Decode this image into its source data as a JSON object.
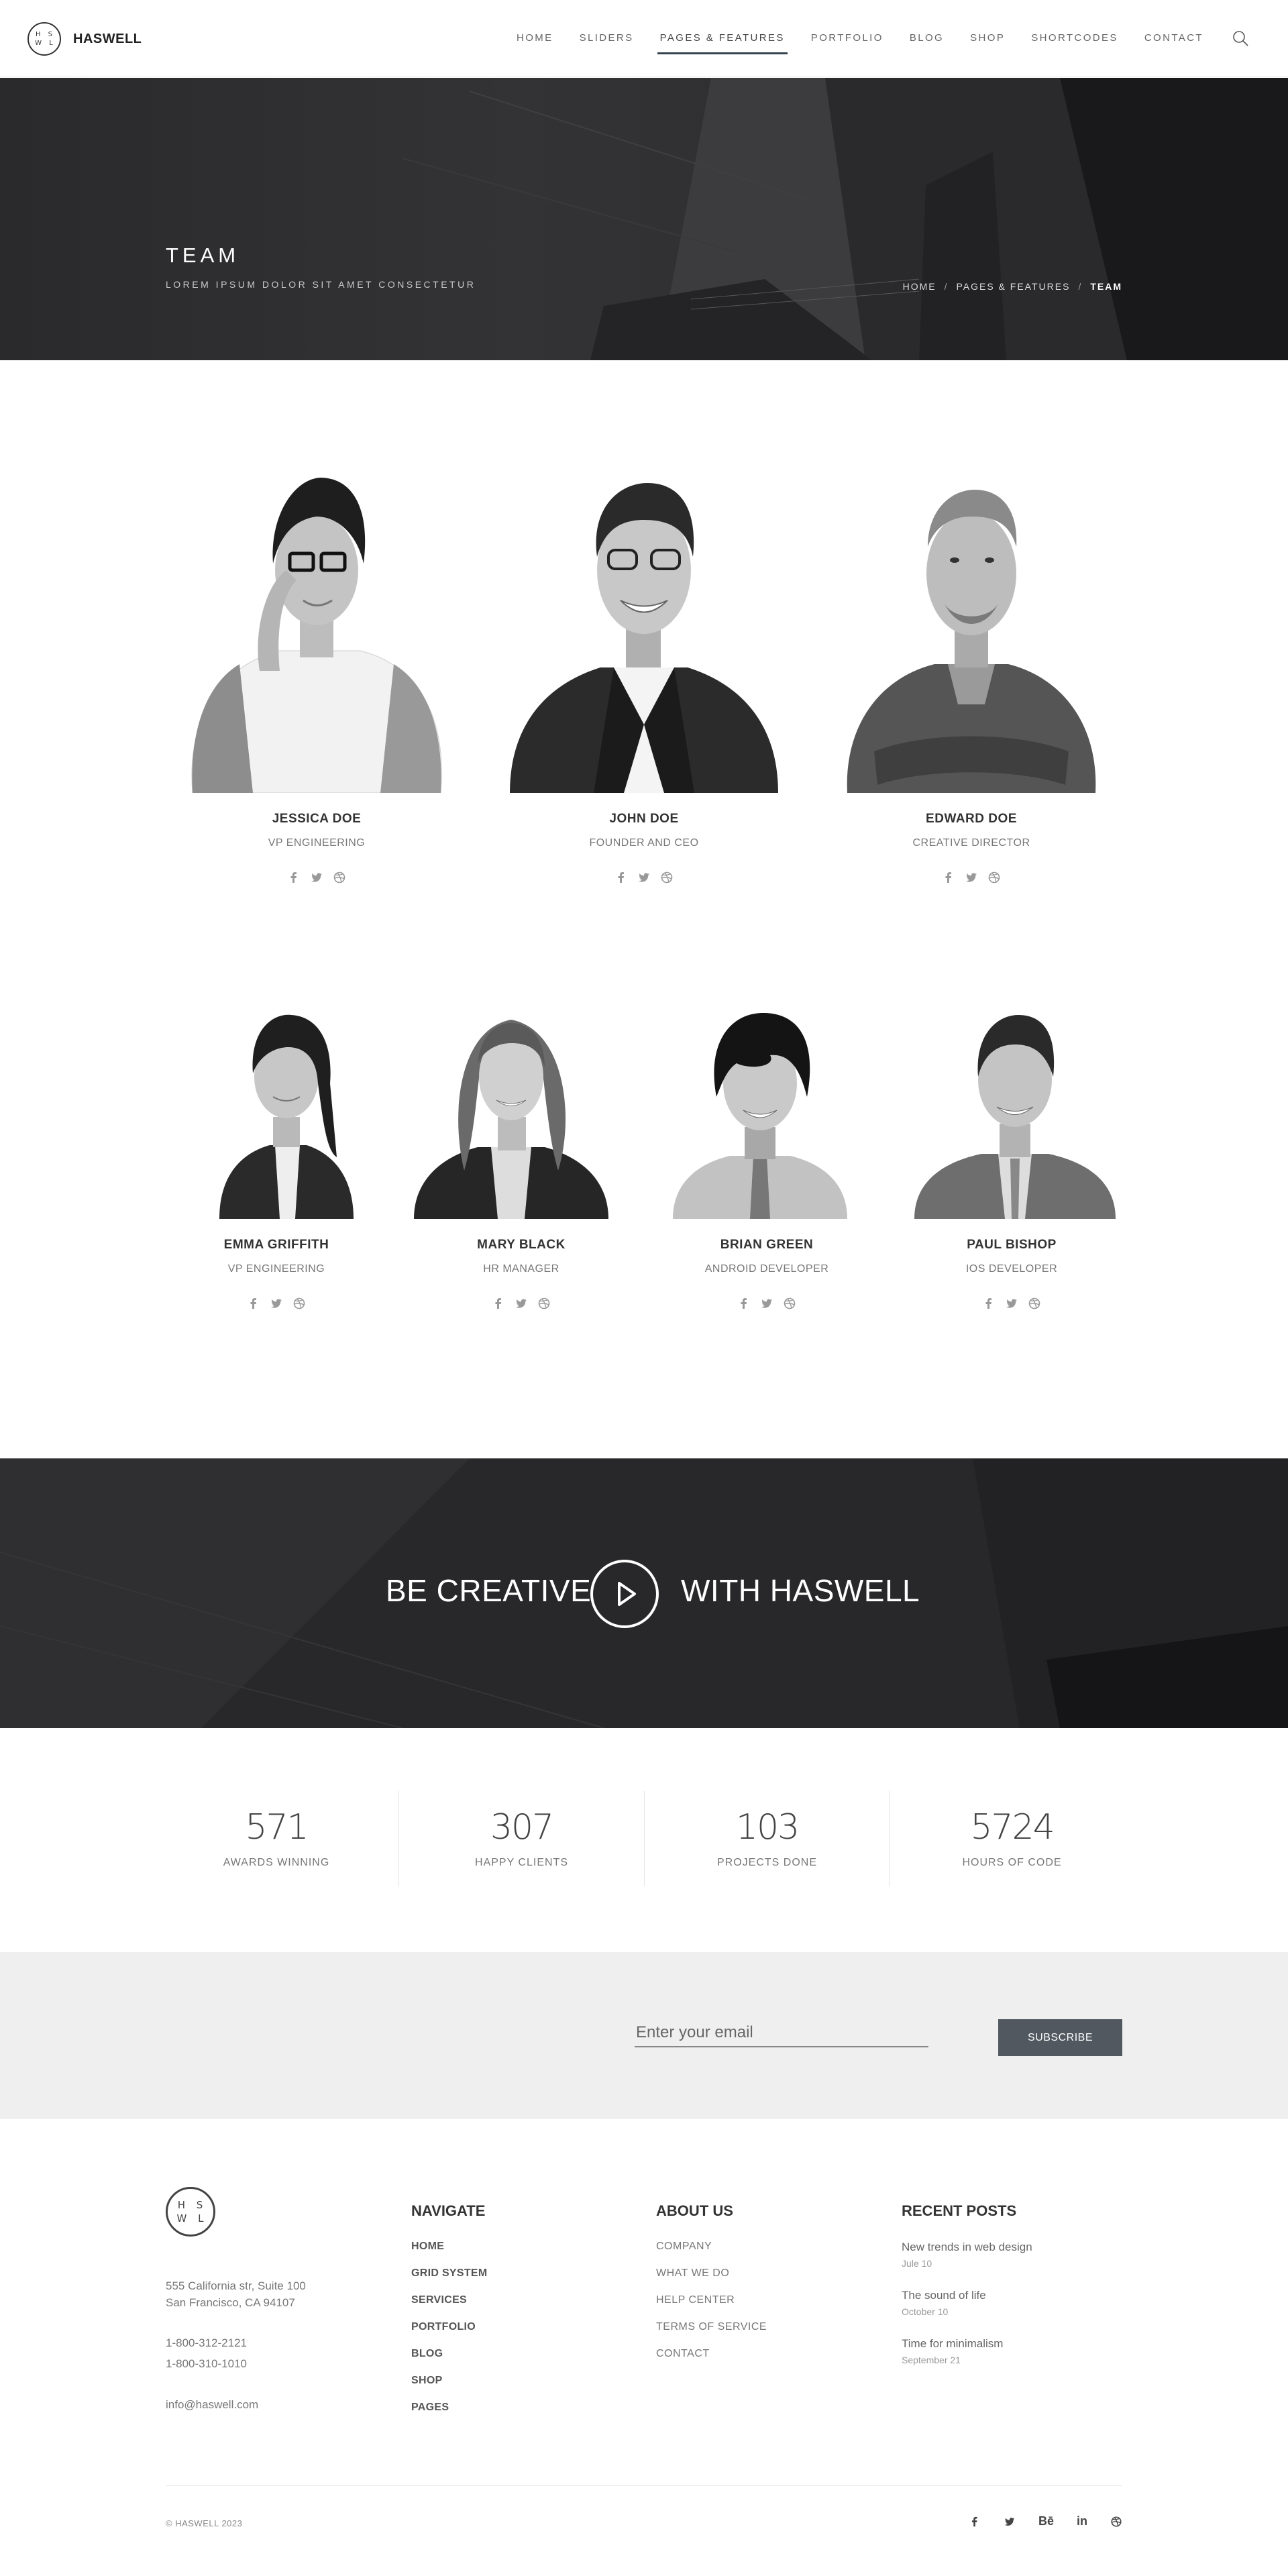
{
  "nav": {
    "logo_monogram": "H S W L",
    "brand": "HASWELL",
    "items": [
      "HOME",
      "SLIDERS",
      "PAGES & FEATURES",
      "PORTFOLIO",
      "BLOG",
      "SHOP",
      "SHORTCODES",
      "CONTACT"
    ],
    "active_item": "PAGES & FEATURES",
    "search_icon": "search-icon"
  },
  "hero": {
    "title": "TEAM",
    "subtitle": "LOREM IPSUM DOLOR SIT AMET CONSECTETUR",
    "breadcrumb": [
      "HOME",
      "PAGES & FEATURES",
      "TEAM"
    ],
    "separator": "/"
  },
  "team": [
    {
      "name": "JESSICA DOE",
      "role": "VP ENGINEERING",
      "social": [
        "facebook-icon",
        "twitter-icon",
        "dribbble-icon"
      ]
    },
    {
      "name": "JOHN DOE",
      "role": "FOUNDER AND CEO",
      "social": [
        "facebook-icon",
        "twitter-icon",
        "dribbble-icon"
      ]
    },
    {
      "name": "EDWARD DOE",
      "role": "CREATIVE DIRECTOR",
      "social": [
        "facebook-icon",
        "twitter-icon",
        "dribbble-icon"
      ]
    },
    {
      "name": "EMMA GRIFFITH",
      "role": "VP ENGINEERING",
      "social": [
        "facebook-icon",
        "twitter-icon",
        "dribbble-icon"
      ]
    },
    {
      "name": "MARY BLACK",
      "role": "HR MANAGER",
      "social": [
        "facebook-icon",
        "twitter-icon",
        "dribbble-icon"
      ]
    },
    {
      "name": "BRIAN GREEN",
      "role": "ANDROID DEVELOPER",
      "social": [
        "facebook-icon",
        "twitter-icon",
        "dribbble-icon"
      ]
    },
    {
      "name": "PAUL BISHOP",
      "role": "IOS DEVELOPER",
      "social": [
        "facebook-icon",
        "twitter-icon",
        "dribbble-icon"
      ]
    }
  ],
  "banner": {
    "left_text": "BE CREATIVE",
    "right_text": "WITH HASWELL",
    "play_icon": "play-icon"
  },
  "counters": [
    {
      "value": "571",
      "label": "AWARDS WINNING"
    },
    {
      "value": "307",
      "label": "HAPPY CLIENTS"
    },
    {
      "value": "103",
      "label": "PROJECTS DONE"
    },
    {
      "value": "5724",
      "label": "HOURS OF CODE"
    }
  ],
  "newsletter": {
    "placeholder": "Enter your email",
    "button": "SUBSCRIBE"
  },
  "footer": {
    "logo_monogram": "H S W L",
    "address_line1": "555 California str, Suite 100",
    "address_line2": "San Francisco, CA 94107",
    "phone1": "1-800-312-2121",
    "phone2": "1-800-310-1010",
    "email": "info@haswell.com",
    "navigate_heading": "NAVIGATE",
    "navigate": [
      "HOME",
      "GRID SYSTEM",
      "SERVICES",
      "PORTFOLIO",
      "BLOG",
      "SHOP",
      "PAGES"
    ],
    "about_heading": "ABOUT US",
    "about": [
      "COMPANY",
      "WHAT WE DO",
      "HELP CENTER",
      "TERMS OF SERVICE",
      "CONTACT"
    ],
    "posts_heading": "RECENT POSTS",
    "posts": [
      {
        "title": "New trends in web design",
        "date": "Jule 10"
      },
      {
        "title": "The sound of life",
        "date": "October 10"
      },
      {
        "title": "Time for minimalism",
        "date": "September 21"
      }
    ],
    "copyright": "© HASWELL 2023",
    "social": [
      "f",
      "twitter",
      "Bē",
      "in",
      "dribbble"
    ]
  }
}
